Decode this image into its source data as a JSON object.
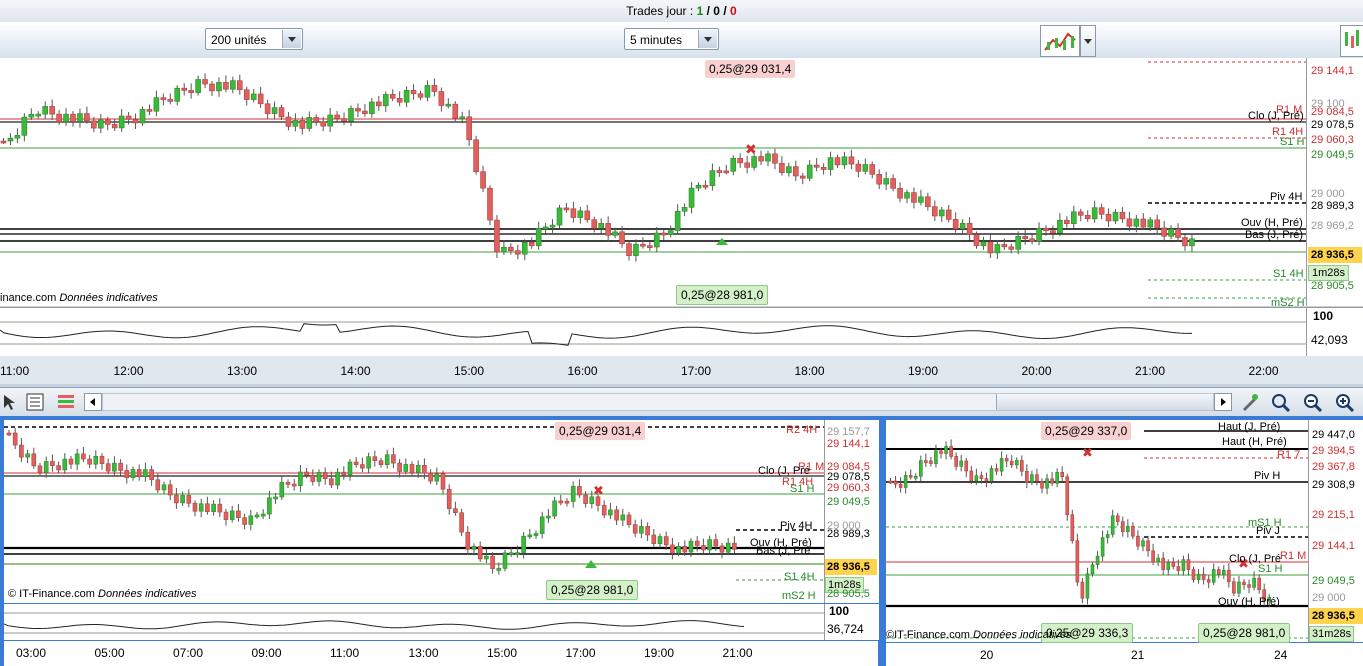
{
  "header": {
    "title_prefix": "Trades jour :",
    "count_a": "1",
    "sep1": "/",
    "count_b": "0",
    "sep2": "/",
    "count_c": "0"
  },
  "toolbar": {
    "units_value": "200 unités",
    "timeframe_value": "5 minutes"
  },
  "main_chart": {
    "credit": "inance.com",
    "credit_note": "Données indicatives",
    "top_tag": "0,25@29 031,4",
    "bottom_tag": "0,25@28 981,0",
    "line_labels": {
      "r1m": "R1 M",
      "clo": "Clo (J, Pré)",
      "r1_4h": "R1 4H",
      "s1h": "S1 H",
      "piv4h": "Piv 4H",
      "ouv": "Ouv (H, Pré)",
      "bas": "Bas (J, Pré)",
      "s1_4h": "S1 4H",
      "ms2h": "mS2 H"
    },
    "price_scale": [
      "29 144,1",
      "29 100",
      "29 084,5",
      "29 078,5",
      "29 060,3",
      "29 049,5",
      "29 000",
      "28 989,3",
      "28 969,2",
      "28 936,5",
      "1m28s",
      "28 905,5"
    ],
    "osc_scale": [
      "100",
      "42,093"
    ],
    "time_labels": [
      "11:00",
      "12:00",
      "13:00",
      "14:00",
      "15:00",
      "16:00",
      "17:00",
      "18:00",
      "19:00",
      "20:00",
      "21:00",
      "22:00"
    ]
  },
  "bottom_left": {
    "credit": "© IT-Finance.com",
    "credit_note": "Données indicatives",
    "top_tag": "0,25@29 031,4",
    "bottom_tag": "0,25@28 981,0",
    "line_labels": {
      "r2_4h": "R2 4H",
      "r1m": "R1 M",
      "clo": "Clo (J, Pré",
      "r1_4h": "R1 4H",
      "s1h": "S1 H",
      "piv4h": "Piv 4H",
      "ouv": "Ouv (H, Pré)",
      "bas": "Bas (J, Pré",
      "s1_4h": "S1 4H",
      "ms2h": "mS2 H"
    },
    "price_scale": [
      "29 157,7",
      "29 144,1",
      "29 084,5",
      "29 078,5",
      "29 060,3",
      "29 049,5",
      "29 000",
      "28 989,3",
      "28 936,5",
      "1m28s",
      "28 905,5"
    ],
    "osc_scale": [
      "100",
      "36,724"
    ],
    "time_labels": [
      "03:00",
      "05:00",
      "07:00",
      "09:00",
      "11:00",
      "13:00",
      "15:00",
      "17:00",
      "19:00",
      "21:00"
    ]
  },
  "bottom_right": {
    "credit": "©IT-Finance.com",
    "credit_note": "Données indicatives",
    "top_tag": "0,25@29 337,0",
    "bottom_tag_a": "0,25@29 336,3",
    "bottom_tag_b": "0,25@28 981,0",
    "line_labels": {
      "haut": "Haut (J, Pré)",
      "haut_h": "Haut (H, Pré)",
      "r1_7": "R1 7",
      "piv_h": "Piv H",
      "ms1h": "mS1 H",
      "piv_j": "Piv J",
      "r1m": "R1 M",
      "clo": "Clo (J, Pré",
      "s1h": "S1 H",
      "ouv": "Ouv (H, Pré)"
    },
    "price_scale": [
      "29 447,0",
      "29 394,5",
      "29 367,8",
      "29 308,9",
      "29 215,1",
      "29 144,1",
      "29 049,5",
      "29 000",
      "28 936,5",
      "31m28s"
    ],
    "time_labels": [
      "20",
      "21",
      "24"
    ]
  },
  "colors": {
    "up": "#3cb83c",
    "down": "#e06060",
    "red_line": "#d03030",
    "green_line": "#3aa03a",
    "current_price": "#ffd34d"
  }
}
